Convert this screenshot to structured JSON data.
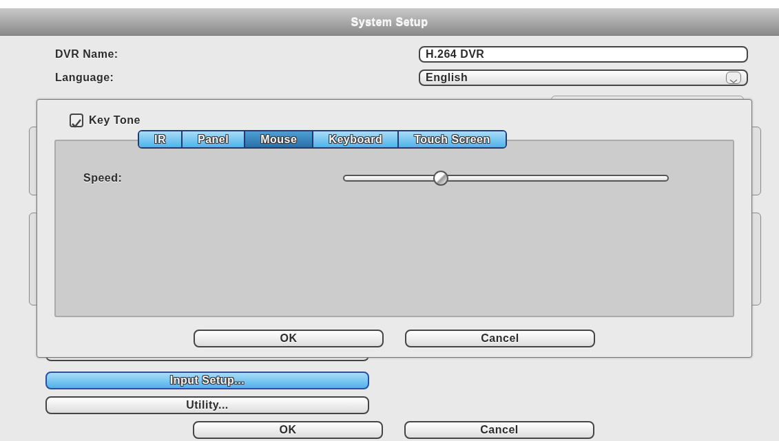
{
  "window": {
    "title": "System Setup"
  },
  "fields": [
    {
      "label": "DVR Name:",
      "kind": "text",
      "value": "H.264 DVR"
    },
    {
      "label": "Language:",
      "kind": "select",
      "value": "English"
    }
  ],
  "dialog": {
    "key_tone": {
      "label": "Key Tone",
      "checked": true
    },
    "tabs": [
      {
        "label": "IR",
        "selected": false
      },
      {
        "label": "Panel",
        "selected": false
      },
      {
        "label": "Mouse",
        "selected": true
      },
      {
        "label": "Keyboard",
        "selected": false
      },
      {
        "label": "Touch Screen",
        "selected": false
      }
    ],
    "speed": {
      "label": "Speed:",
      "level": 0.3
    },
    "buttons": [
      "OK",
      "Cancel"
    ]
  },
  "menu_buttons": [
    {
      "label": "Input Setup...",
      "selected": true
    },
    {
      "label": "Utility...",
      "selected": false
    }
  ],
  "buttons": [
    "OK",
    "Cancel"
  ]
}
